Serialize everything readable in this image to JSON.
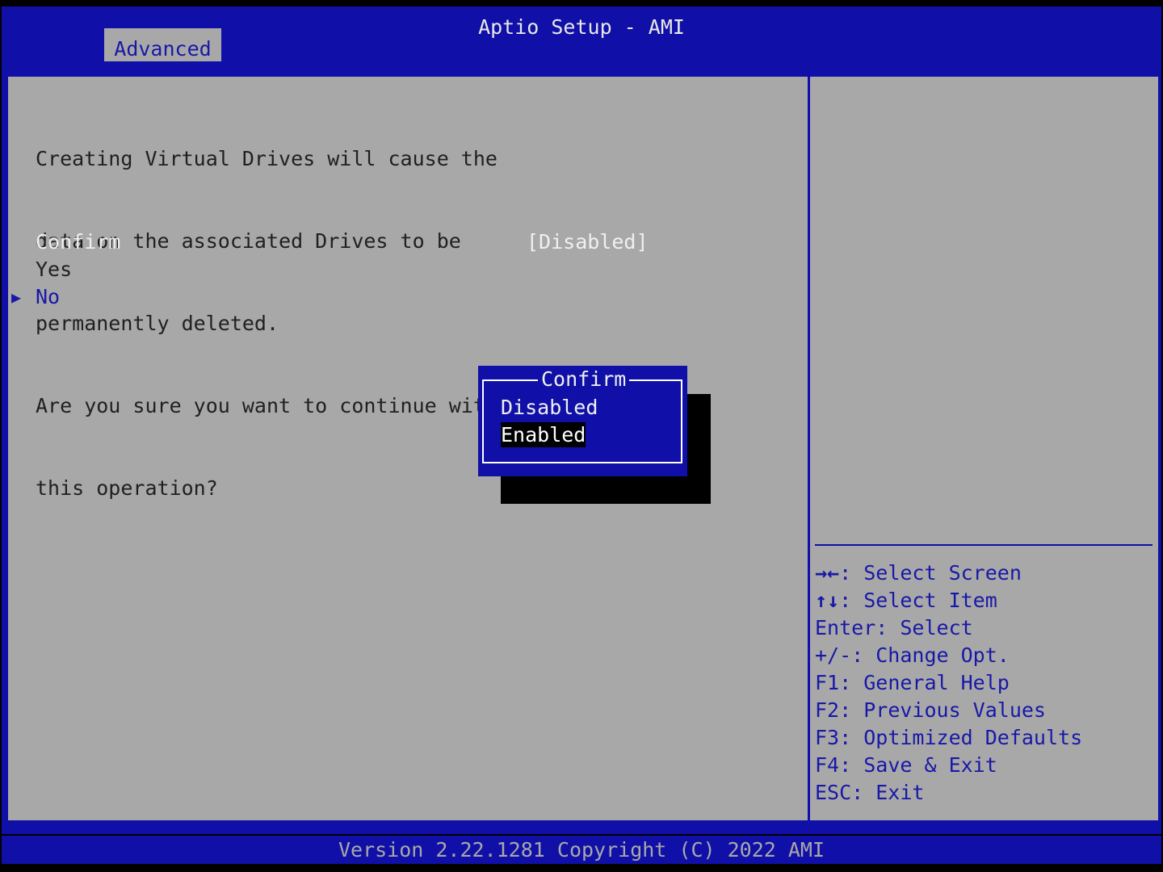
{
  "header": {
    "title": "Aptio Setup - AMI",
    "tabs": [
      {
        "label": "Advanced"
      }
    ]
  },
  "main": {
    "description_lines": [
      "Creating Virtual Drives will cause the",
      "data on the associated Drives to be",
      "permanently deleted.",
      "Are you sure you want to continue with",
      "this operation?"
    ],
    "confirm_label": "Confirm",
    "confirm_value": "[Disabled]",
    "yes_label": "Yes",
    "no_label": "No",
    "pointer_glyph": "▶"
  },
  "popup": {
    "title": "Confirm",
    "options": [
      "Disabled",
      "Enabled"
    ],
    "selected": "Enabled"
  },
  "help": {
    "items": [
      {
        "key": "→←",
        "text": ": Select Screen"
      },
      {
        "key": "↑↓",
        "text": ": Select Item"
      },
      {
        "key": "Enter",
        "text": ": Select"
      },
      {
        "key": "+/-",
        "text": ": Change Opt."
      },
      {
        "key": "F1",
        "text": ": General Help"
      },
      {
        "key": "F2",
        "text": ": Previous Values"
      },
      {
        "key": "F3",
        "text": ": Optimized Defaults"
      },
      {
        "key": "F4",
        "text": ": Save & Exit"
      },
      {
        "key": "ESC",
        "text": ": Exit"
      }
    ]
  },
  "footer": {
    "version": "Version 2.22.1281 Copyright (C) 2022 AMI"
  },
  "colors": {
    "bios_blue": "#1010a8",
    "panel_gray": "#a8a8a8",
    "highlight_white": "#f0f0f0",
    "selected_bg": "#000000"
  }
}
